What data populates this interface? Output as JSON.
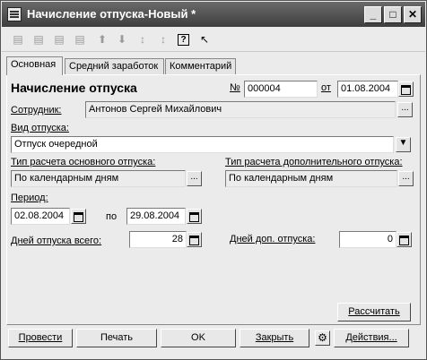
{
  "window": {
    "title": "Начисление отпуска-Новый *"
  },
  "titlebar_buttons": {
    "minimize": "_",
    "maximize": "□",
    "close": "✕"
  },
  "toolbar_icons": [
    "insert-icon",
    "copy-icon",
    "delete-icon",
    "edit-icon",
    "move-up-icon",
    "move-down-icon",
    "sort-asc-icon",
    "sort-desc-icon",
    "help-icon",
    "context-help-icon"
  ],
  "tabs": [
    "Основная",
    "Средний заработок",
    "Комментарий"
  ],
  "header": {
    "heading": "Начисление отпуска",
    "number_label": "№",
    "number": "000004",
    "date_label": "от",
    "date": "01.08.2004"
  },
  "employee": {
    "label": "Сотрудник:",
    "value": "Антонов Сергей Михайлович"
  },
  "vacation_type": {
    "label": "Вид отпуска:",
    "value": "Отпуск очередной"
  },
  "calc_main": {
    "label": "Тип расчета основного отпуска:",
    "value": "По календарным дням"
  },
  "calc_extra": {
    "label": "Тип расчета дополнительного отпуска:",
    "value": "По календарным дням"
  },
  "period": {
    "label": "Период:",
    "from": "02.08.2004",
    "to_label": "по",
    "to": "29.08.2004"
  },
  "days_total": {
    "label": "Дней отпуска всего:",
    "value": "28"
  },
  "days_extra": {
    "label": "Дней доп. отпуска:",
    "value": "0"
  },
  "buttons": {
    "calculate": "Рассчитать",
    "post": "Провести",
    "print": "Печать",
    "ok": "OK",
    "close": "Закрыть",
    "actions": "Действия..."
  }
}
